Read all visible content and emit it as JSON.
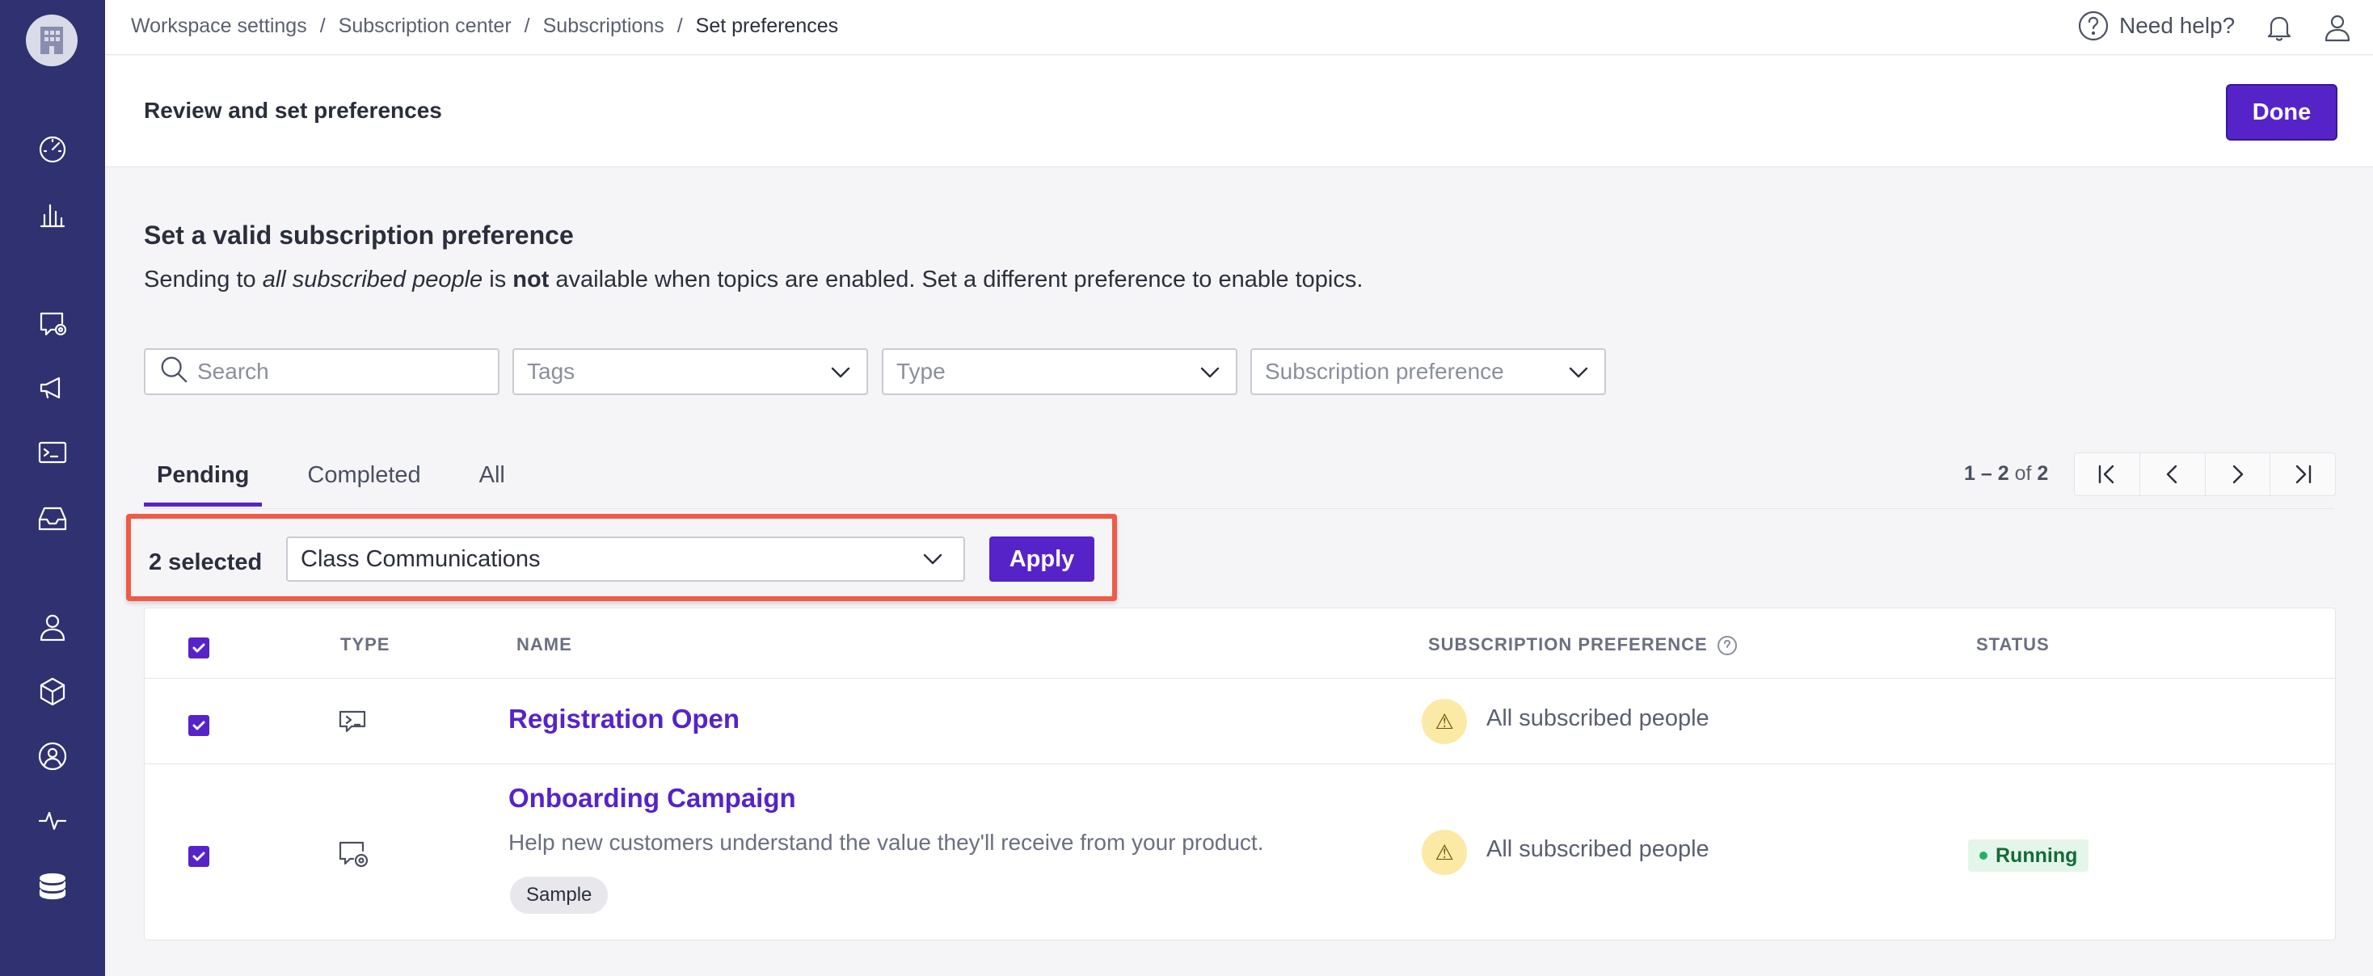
{
  "breadcrumb": [
    "Workspace settings",
    "Subscription center",
    "Subscriptions",
    "Set preferences"
  ],
  "breadcrumb_sep": "/",
  "topbar": {
    "help_label": "Need help?"
  },
  "header": {
    "title": "Review and set preferences",
    "done_label": "Done"
  },
  "section": {
    "title": "Set a valid subscription preference",
    "desc_1": "Sending to ",
    "desc_em": "all subscribed people",
    "desc_2": " is ",
    "desc_bold": "not",
    "desc_3": " available when topics are enabled. Set a different preference to enable topics."
  },
  "filters": {
    "search_placeholder": "Search",
    "tags": "Tags",
    "type": "Type",
    "subscription_preference": "Subscription preference"
  },
  "tabs": [
    "Pending",
    "Completed",
    "All"
  ],
  "pager": {
    "range": "1 – 2",
    "of": "of",
    "total": "2"
  },
  "bulk": {
    "count_label": "2 selected",
    "selected_value": "Class Communications",
    "apply_label": "Apply"
  },
  "table": {
    "headers": {
      "type": "TYPE",
      "name": "NAME",
      "pref": "SUBSCRIPTION PREFERENCE",
      "status": "STATUS"
    },
    "rows": [
      {
        "name": "Registration Open",
        "type_icon": "broadcast-icon",
        "preference": "All subscribed people",
        "status": ""
      },
      {
        "name": "Onboarding Campaign",
        "type_icon": "campaign-icon",
        "description": "Help new customers understand the value they'll receive from your product.",
        "tag": "Sample",
        "preference": "All subscribed people",
        "status": "Running"
      }
    ]
  },
  "colors": {
    "sidebar": "#2f3170",
    "accent": "#5623c9",
    "highlight": "#ee5b47",
    "warn_bg": "#fbe9a6",
    "running": "#22b35e"
  }
}
